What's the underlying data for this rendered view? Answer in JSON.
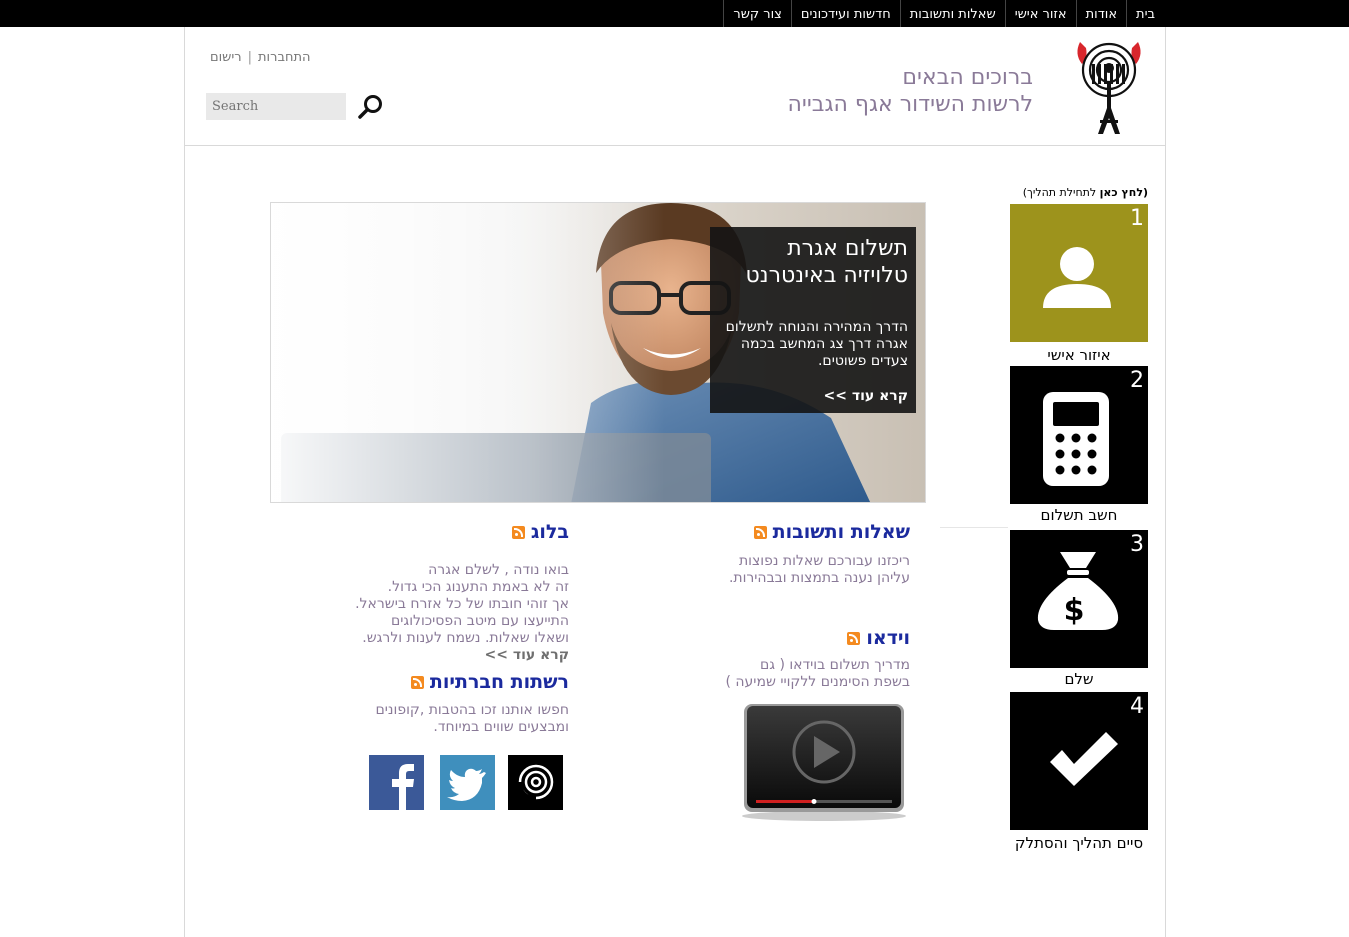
{
  "topnav": {
    "items": [
      "בית",
      "אודות",
      "אזור אישי",
      "שאלות ותשובות",
      "חדשות ועידכונים",
      "צור קשר"
    ]
  },
  "header": {
    "welcome_line1": "ברוכים הבאים",
    "welcome_line2": "לרשות השידור אגף הגבייה",
    "register": "רישום",
    "login": "התחברות",
    "separator": "|",
    "search_placeholder": "Search"
  },
  "steps": {
    "caption_bold_open": "(לחץ כאן",
    "caption_rest": " לתחילת תהליך)",
    "items": [
      {
        "num": "1",
        "label": "איזור אישי",
        "color": "#9d931c",
        "icon": "user-icon"
      },
      {
        "num": "2",
        "label": "חשב תשלום",
        "color": "#000000",
        "icon": "calculator-icon"
      },
      {
        "num": "3",
        "label": "שלם",
        "color": "#000000",
        "icon": "money-bag-icon"
      },
      {
        "num": "4",
        "label": "סיים תהליך והסתלק",
        "color": "#000000",
        "icon": "checkmark-icon"
      }
    ]
  },
  "hero": {
    "title_line1": "תשלום אגרת",
    "title_line2": "טלויזיה באינטרנט",
    "text": "הדרך המהירה והנוחה לתשלום אגרה דרך צג המחשב בכמה צעדים פשוטים.",
    "more": "קרא עוד >>"
  },
  "faq": {
    "title": "שאלות ותשובות",
    "text_line1": "ריכזנו עבורכם שאלות נפוצות",
    "text_line2": "עליהן נענה בתמצות ובבהירות."
  },
  "video": {
    "title": "וידאו",
    "text_line1": "מדריך תשלום בוידאו ( גם",
    "text_line2": "בשפת הסימנים ללקויי שמיעה )"
  },
  "blog": {
    "title": "בלוג",
    "lines": [
      "בואו נודה , לשלם אגרה",
      "זה לא באמת התענוג הכי גדול.",
      "אך זוהי חובתו של כל אזרח בישראל.",
      "התייעצו עם מיטב הפסיכולוגים",
      "ושאלו שאלות. נשמח לענות ולרגש."
    ],
    "more": "קרא עוד >>"
  },
  "social": {
    "title": "רשתות חברתיות",
    "text_line1": "חפשו אותנו זכו בהטבות ,קופונים",
    "text_line2": "ומבצעים שווים במיוחד."
  },
  "colors": {
    "accent_title": "#1b2a9e",
    "body_text": "#8a7a98",
    "facebook": "#3b5998",
    "twitter": "#3f8fbd"
  }
}
